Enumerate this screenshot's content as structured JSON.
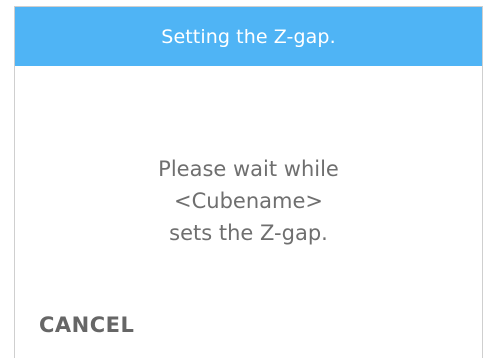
{
  "dialog": {
    "title": "Setting the Z-gap.",
    "message_lines": [
      "Please wait while",
      "<Cubename>",
      "sets the Z-gap."
    ],
    "cancel_label": "CANCEL"
  },
  "colors": {
    "title_bar": "#4fb4f5",
    "title_text": "#ffffff",
    "message_text": "#6f6f6f",
    "cancel_text": "#666666",
    "border": "#cfcfcf"
  }
}
